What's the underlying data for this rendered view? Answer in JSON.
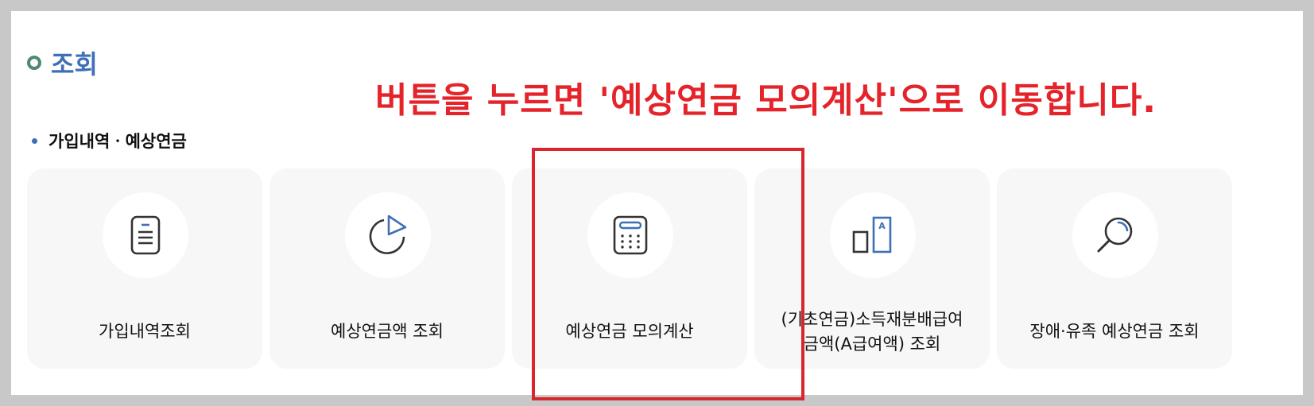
{
  "section": {
    "title": "조회"
  },
  "notice": "버튼을 누르면 '예상연금 모의계산'으로 이동합니다.",
  "subhead": "가입내역ㆍ예상연금",
  "cards": [
    {
      "label": "가입내역조회",
      "icon": "document-icon"
    },
    {
      "label": "예상연금액 조회",
      "icon": "pie-chart-icon"
    },
    {
      "label": "예상연금 모의계산",
      "icon": "calculator-icon"
    },
    {
      "label_line1": "(기초연금)소득재분배급여",
      "label_line2": "금액(A급여액) 조회",
      "icon": "bar-a-icon"
    },
    {
      "label": "장애·유족 예상연금 조회",
      "icon": "search-icon"
    }
  ],
  "colors": {
    "accent_blue": "#3f6fb6",
    "ring_green": "#4d8a6e",
    "notice_red": "#e5232a",
    "highlight_red": "#d9262b",
    "card_bg": "#f7f7f7"
  }
}
